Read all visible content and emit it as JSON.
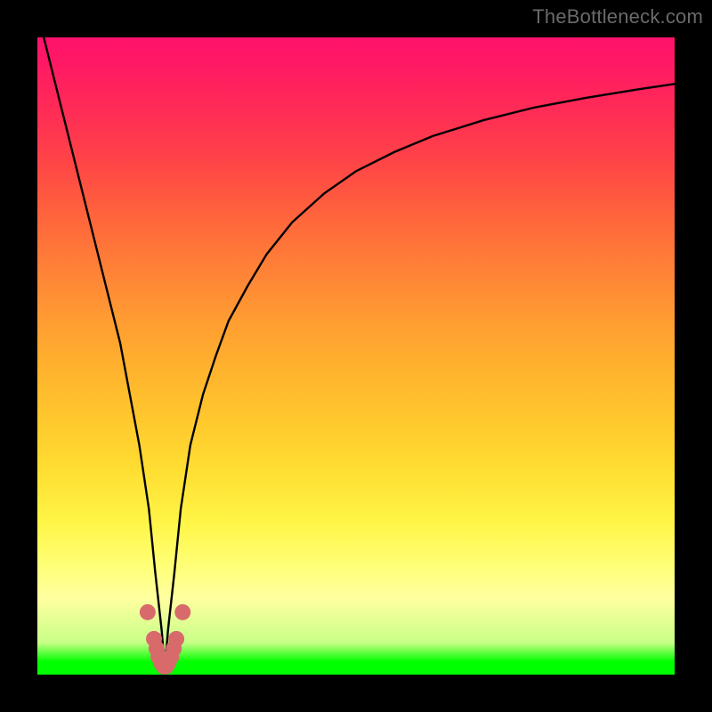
{
  "watermark": "TheBottleneck.com",
  "colors": {
    "frame": "#000000",
    "curve": "#000000",
    "markers": "#d86a6c",
    "gradient_top": "#ff1a6c",
    "gradient_bottom": "#00ff00"
  },
  "chart_data": {
    "type": "line",
    "title": "",
    "xlabel": "",
    "ylabel": "",
    "xlim": [
      0,
      100
    ],
    "ylim": [
      0,
      100
    ],
    "grid": false,
    "legend": false,
    "notch_x": 20,
    "series": [
      {
        "name": "bottleneck-curve",
        "x": [
          1,
          3,
          5,
          7,
          9,
          11,
          13,
          14.5,
          16,
          17.5,
          18.5,
          19.5,
          20,
          20.5,
          21.5,
          22.5,
          24,
          26,
          28,
          30,
          33,
          36,
          40,
          45,
          50,
          56,
          62,
          70,
          78,
          86,
          94,
          100
        ],
        "y": [
          100,
          92,
          84,
          76,
          68,
          60,
          52,
          44,
          36,
          26,
          16,
          7,
          1,
          7,
          16,
          26,
          36,
          44,
          50,
          55.5,
          61,
          66,
          71,
          75.5,
          79,
          82,
          84.5,
          87,
          89,
          90.5,
          91.8,
          92.7
        ]
      }
    ],
    "markers": {
      "name": "highlighted-range",
      "x": [
        17.3,
        18.3,
        18.7,
        19.0,
        19.4,
        19.8,
        20.2,
        20.6,
        21.0,
        21.4,
        21.8,
        22.8
      ],
      "y": [
        9.8,
        5.6,
        4.1,
        2.8,
        1.9,
        1.3,
        1.3,
        1.9,
        2.8,
        4.1,
        5.6,
        9.8
      ]
    }
  }
}
